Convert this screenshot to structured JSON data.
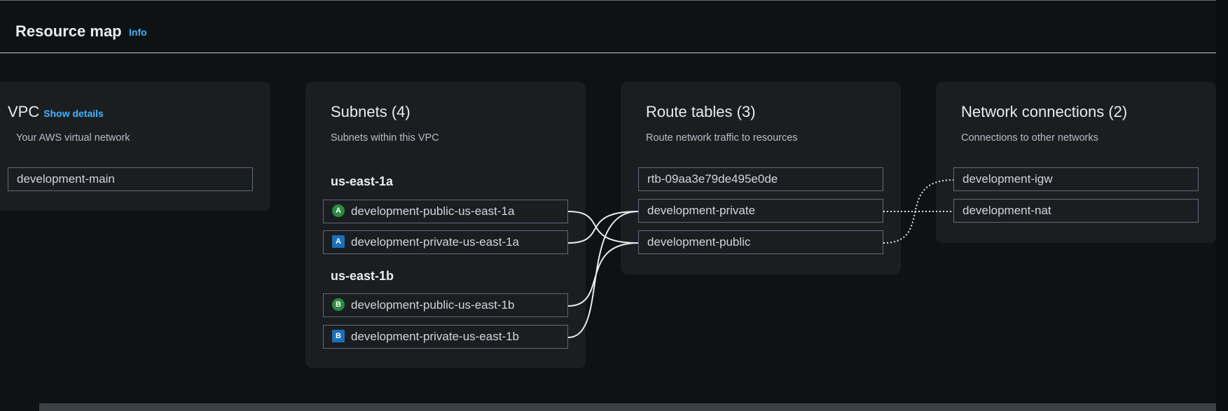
{
  "header": {
    "title": "Resource map",
    "info_label": "Info"
  },
  "vpc": {
    "title": "VPC",
    "show_details": "Show details",
    "subtitle": "Your AWS virtual network",
    "items": [
      "development-main"
    ]
  },
  "subnets": {
    "title": "Subnets (4)",
    "subtitle": "Subnets within this VPC",
    "zones": [
      {
        "name": "us-east-1a",
        "items": [
          {
            "badge": "A",
            "kind": "public",
            "label": "development-public-us-east-1a"
          },
          {
            "badge": "A",
            "kind": "private",
            "label": "development-private-us-east-1a"
          }
        ]
      },
      {
        "name": "us-east-1b",
        "items": [
          {
            "badge": "B",
            "kind": "public",
            "label": "development-public-us-east-1b"
          },
          {
            "badge": "B",
            "kind": "private",
            "label": "development-private-us-east-1b"
          }
        ]
      }
    ]
  },
  "route_tables": {
    "title": "Route tables (3)",
    "subtitle": "Route network traffic to resources",
    "items": [
      "rtb-09aa3e79de495e0de",
      "development-private",
      "development-public"
    ]
  },
  "network_connections": {
    "title": "Network connections (2)",
    "subtitle": "Connections to other networks",
    "items": [
      "development-igw",
      "development-nat"
    ]
  },
  "colors": {
    "background": "#0f1214",
    "card": "#1b1e21",
    "link": "#42b4ff",
    "public_badge": "#2b8a3e",
    "private_badge": "#1d6fb8"
  }
}
